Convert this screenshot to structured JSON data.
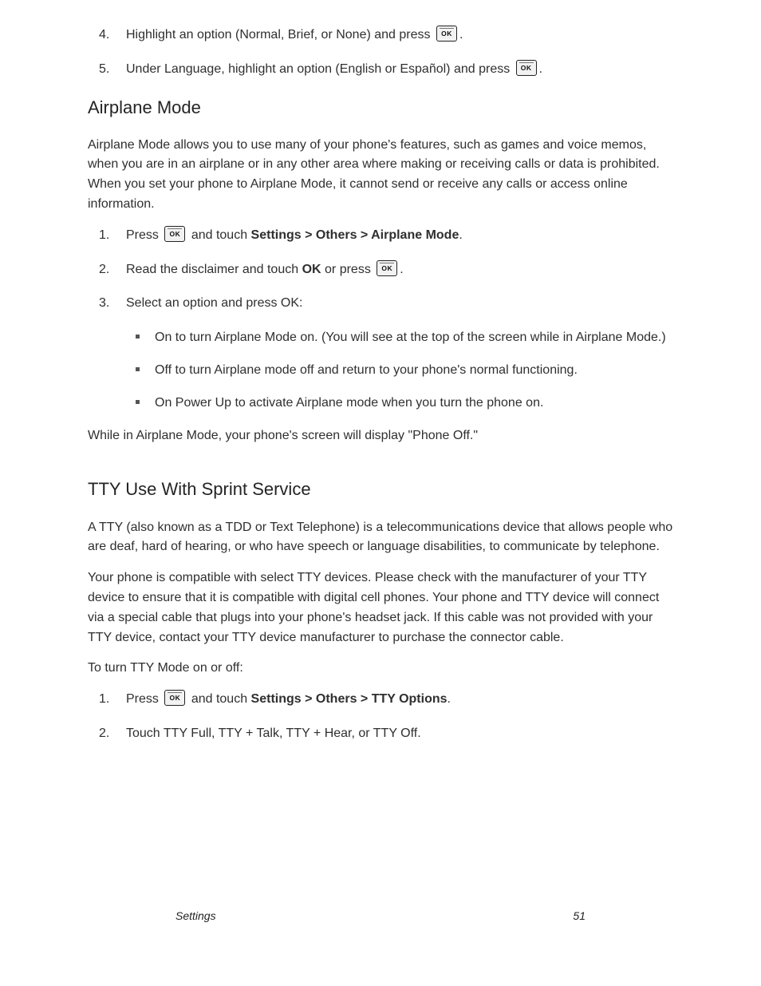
{
  "sec1": {
    "steps": [
      "Highlight an option (Normal, Brief, or None) and press",
      "Under Language, highlight an option (English or Español) and press"
    ],
    "tail": "."
  },
  "sec2": {
    "title": "Airplane Mode",
    "p1": "Airplane Mode allows you to use many of your phone's features, such as games and voice memos, when you are in an airplane or in any other area where making or receiving calls or data is prohibited. When you set your phone to Airplane Mode, it cannot send or receive any calls or access online information.",
    "step1_a": "Press",
    "step1_b": " and touch",
    "step1_c": "Settings > Others > Airplane Mode",
    "step2_a": "Read the disclaimer and touch",
    "step2_b": "or press",
    "step3": "Select an option and press OK:",
    "opts": [
      "On to turn Airplane Mode on. (You will see       at the top of the screen while in Airplane Mode.)",
      "Off to turn Airplane mode off and return to your phone's normal functioning.",
      "On Power Up to activate Airplane mode when you turn the phone on."
    ],
    "p2": "While in Airplane Mode, your phone's screen will display \"Phone Off.\""
  },
  "sec3": {
    "title": "TTY Use With Sprint Service",
    "p1": "A TTY (also known as a TDD or Text Telephone) is a telecommunications device that allows people who are deaf, hard of hearing, or who have speech or language disabilities, to communicate by telephone.",
    "p2": "Your phone is compatible with select TTY devices. Please check with the manufacturer of your TTY device to ensure that it is compatible with digital cell phones. Your phone and TTY device will connect via a special cable that plugs into your phone's headset jack. If this cable was not provided with your TTY device, contact your TTY device manufacturer to purchase the connector cable.",
    "lead": "To turn TTY Mode on or off:",
    "step1_a": "Press",
    "step1_b": " and touch",
    "step1_c": "Settings > Others > TTY Options",
    "step2": "Touch TTY Full, TTY + Talk, TTY + Hear, or TTY Off."
  },
  "footer": {
    "left": "Settings",
    "right": "51"
  },
  "labels": {
    "ok": "OK",
    "num1": "1.",
    "num2": "2.",
    "num3": "3.",
    "num4": "4.",
    "num5": "5."
  }
}
